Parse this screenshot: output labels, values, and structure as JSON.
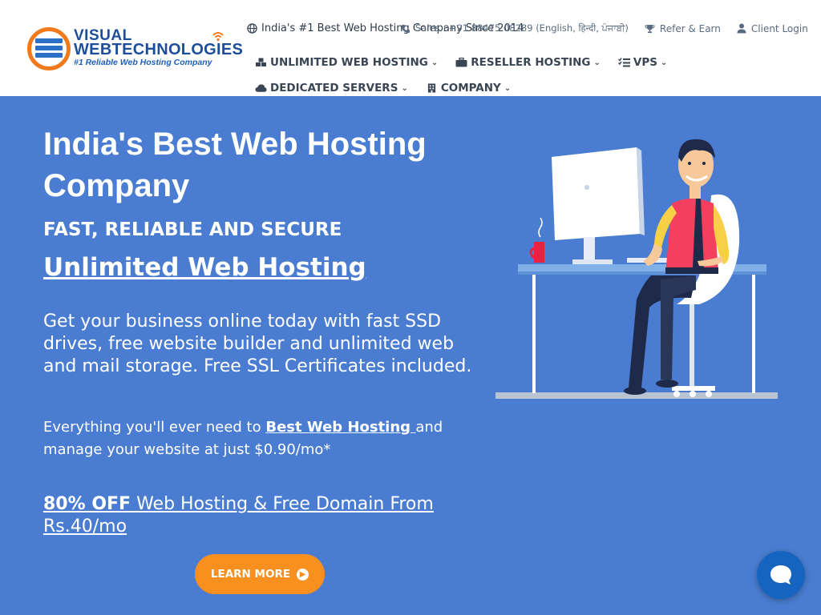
{
  "brand": {
    "name_line1": "VISUAL",
    "name_line2": "WEBTECHNOLOGIES",
    "tagline": "#1 Reliable Web Hosting Company",
    "colors": {
      "primary": "#1d4e9c",
      "accent": "#f07a1c",
      "hero_bg": "#4a7dd1",
      "button": "#f7901e",
      "chat": "#1565c0"
    }
  },
  "topbar": {
    "tagline": "India's #1 Best Web Hosting Company Since 2014",
    "sales": "Sales : +91 88475 08289 (English, हिन्दी, ਪੰਜਾਬੀ)",
    "refer": "Refer & Earn",
    "login": "Client Login"
  },
  "nav": {
    "unlimited": "UNLIMITED WEB HOSTING",
    "reseller": "RESELLER HOSTING",
    "vps": "VPS",
    "dedicated": "DEDICATED SERVERS",
    "company": "COMPANY"
  },
  "hero": {
    "title": "India's Best Web Hosting Company",
    "subtitle1": "FAST, RELIABLE AND SECURE",
    "subtitle2": "Unlimited Web Hosting",
    "description": "Get your business online today with fast SSD drives, free website builder and unlimited web and mail storage. Free SSL Certificates included.",
    "line2_before": "Everything you'll ever need to ",
    "line2_link": "Best Web Hosting ",
    "line2_after": "and manage your website at just $0.90/mo*",
    "promo_bold": "80% OFF",
    "promo_rest": " Web Hosting & Free Domain From Rs.40/mo",
    "cta": "LEARN MORE"
  },
  "icons": [
    "server-logo-icon",
    "globe-icon",
    "phone-icon",
    "trophy-icon",
    "user-icon",
    "cubes-icon",
    "briefcase-icon",
    "tasks-icon",
    "cloud-icon",
    "building-icon",
    "chevron-down-icon",
    "arrow-circle-right-icon",
    "chat-icon"
  ]
}
